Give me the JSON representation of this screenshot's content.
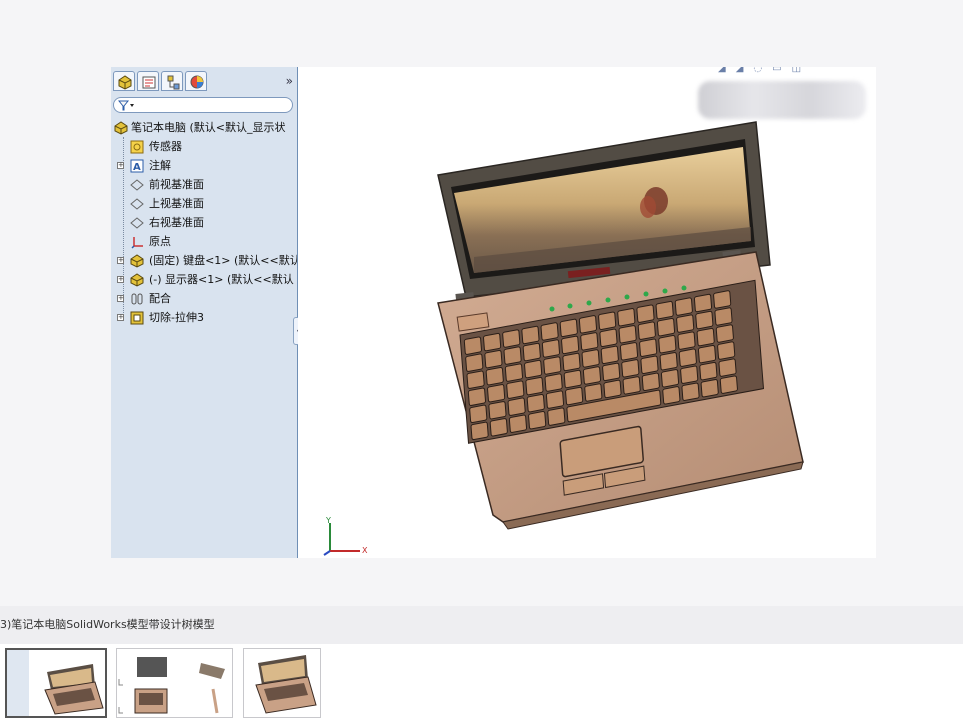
{
  "tree": {
    "more_symbol": "»",
    "items": [
      {
        "label": "笔记本电脑  (默认<默认_显示状",
        "icon": "assembly-icon"
      },
      {
        "label": "传感器",
        "icon": "sensor-icon"
      },
      {
        "label": "注解",
        "icon": "annotation-icon"
      },
      {
        "label": "前视基准面",
        "icon": "plane-icon"
      },
      {
        "label": "上视基准面",
        "icon": "plane-icon"
      },
      {
        "label": "右视基准面",
        "icon": "plane-icon"
      },
      {
        "label": "原点",
        "icon": "origin-icon"
      },
      {
        "label": "(固定) 键盘<1> (默认<<默认",
        "icon": "component-icon"
      },
      {
        "label": "(-) 显示器<1> (默认<<默认",
        "icon": "component-icon"
      },
      {
        "label": "配合",
        "icon": "mates-icon"
      },
      {
        "label": "切除-拉伸3",
        "icon": "cut-extrude-icon"
      }
    ]
  },
  "viewport": {
    "axis_x": "X",
    "axis_y": "Y"
  },
  "caption": "3)笔记本电脑SolidWorks模型带设计树模型",
  "colors": {
    "laptop_body": "#c9a186",
    "laptop_edge": "#3a2a22",
    "tree_bg": "#d9e3ef",
    "key_fill": "#b98a66"
  }
}
